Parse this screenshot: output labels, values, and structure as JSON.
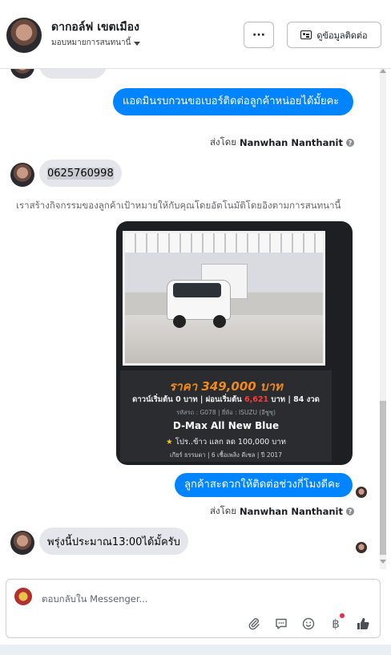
{
  "header": {
    "contact_name": "ดากอล์ฟ เขตเมือง",
    "assign_label": "มอบหมายการสนทนานี้",
    "more_label": "···",
    "contact_info_button": "ดูข้อมูลติดต่อ"
  },
  "thread": {
    "msg_out_1": "แอดมินรบกวนขอเบอร์ติดต่อลูกค้าหน่อยได้มั้ยคะ",
    "sent_by_1_prefix": "ส่งโดย",
    "sent_by_1_name": "Nanwhan Nanthanit",
    "msg_in_1": "0625760998",
    "system_notice": "เราสร้างกิจกรรมของลูกค้าเป้าหมายให้กับคุณโดยอัตโนมัติโดยอิงตามการสนทนานี้",
    "ad": {
      "price": "ราคา 349,000 บาท",
      "down_prefix": "ดาวน์เริ่มต้น 0 บาท | ผ่อนเริ่มต้น ",
      "down_amount": "6,621",
      "down_suffix": " บาท | 84 งวด",
      "spec": "รหัสรถ : G078 | ยี่ห้อ : ISUZU (อีซูซุ)",
      "model": "D-Max All New Blue",
      "promo": "โปร..ข้าว แลก ลด 100,000 บาท",
      "promo_star": "★",
      "footer": "เกียร์ ธรรมดา  |  6 เชื้อเพลิง ดีเซล  |  ปี 2017"
    },
    "msg_out_2": "ลูกค้าสะดวกให้ติดต่อช่วงกี่โมงดีคะ",
    "sent_by_2_prefix": "ส่งโดย",
    "sent_by_2_name": "Nanwhan Nanthanit",
    "msg_in_2": "พรุ่งนี้ประมาณ13:00ได้มั้ครับ"
  },
  "composer": {
    "placeholder": "ตอบกลับใน Messenger..."
  },
  "icons": [
    "more-icon",
    "contact-card-icon",
    "help-icon",
    "attach-icon",
    "saved-reply-icon",
    "emoji-icon",
    "baht-icon",
    "like-icon"
  ],
  "colors": {
    "outgoing_bubble": "#0084ff",
    "incoming_bubble": "#e4e6eb",
    "price_orange": "#f08a1c"
  }
}
